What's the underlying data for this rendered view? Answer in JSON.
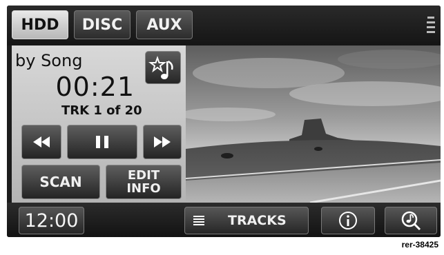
{
  "source_tabs": [
    {
      "label": "HDD",
      "active": true
    },
    {
      "label": "DISC",
      "active": false
    },
    {
      "label": "AUX",
      "active": false
    }
  ],
  "now_playing": {
    "mode": "by Song",
    "elapsed": "00:21",
    "track": "TRK 1 of 20"
  },
  "controls": {
    "scan_label": "SCAN",
    "edit_info_line1": "EDIT",
    "edit_info_line2": "INFO"
  },
  "bottom_bar": {
    "clock": "12:00",
    "tracks_label": "TRACKS"
  },
  "reference_code": "rer-38425",
  "colors": {
    "active_tab": "#d0d0d0",
    "panel": "#c6c6c6",
    "button_dark": "#3a3a3a"
  },
  "icons": [
    "menu-icon",
    "favorite-star-note-icon",
    "rewind-icon",
    "pause-icon",
    "fast-forward-icon",
    "list-icon",
    "info-icon",
    "search-music-icon"
  ]
}
